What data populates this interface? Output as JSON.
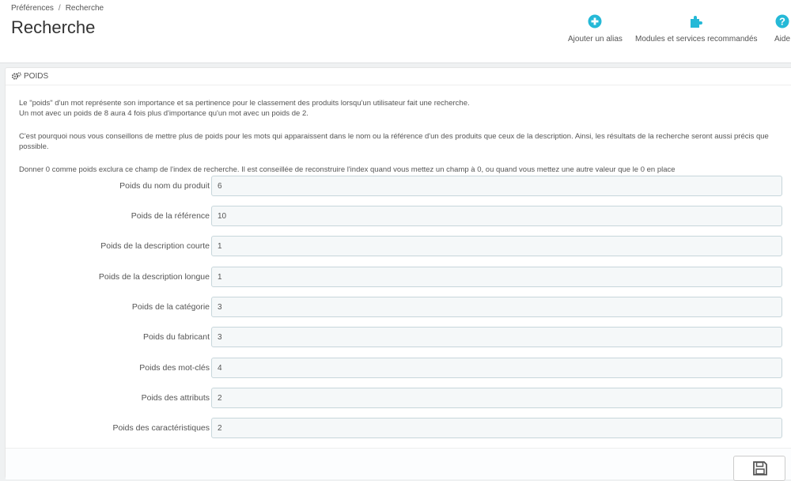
{
  "breadcrumb": {
    "parent": "Préférences",
    "separator": "/",
    "current": "Recherche"
  },
  "page_title": "Recherche",
  "toolbar": {
    "add_alias": {
      "label": "Ajouter un alias",
      "icon": "plus-circle-icon"
    },
    "modules": {
      "label": "Modules et services recommandés",
      "icon": "puzzle-icon"
    },
    "help": {
      "label": "Aide",
      "icon": "question-circle-icon"
    }
  },
  "colors": {
    "accent": "#25b9d7",
    "input_bg": "#f5f8f9",
    "input_border": "#c7d6db"
  },
  "panel": {
    "title": "POIDS",
    "info": [
      "Le \"poids\" d'un mot représente son importance et sa pertinence pour le classement des produits lorsqu'un utilisateur fait une recherche.",
      "Un mot avec un poids de 8 aura 4 fois plus d'importance qu'un mot avec un poids de 2.",
      "C'est pourquoi nous vous conseillons de mettre plus de poids pour les mots qui apparaissent dans le nom ou la référence d'un des produits que ceux de la description. Ainsi, les résultats de la recherche seront aussi précis que possible.",
      "Donner 0 comme poids exclura ce champ de l'index de recherche. Il est conseillée de reconstruire l'index quand vous mettez un champ à 0, ou quand vous mettez une autre valeur que le 0 en place"
    ],
    "fields": [
      {
        "label": "Poids du nom du produit",
        "value": "6"
      },
      {
        "label": "Poids de la référence",
        "value": "10"
      },
      {
        "label": "Poids de la description courte",
        "value": "1"
      },
      {
        "label": "Poids de la description longue",
        "value": "1"
      },
      {
        "label": "Poids de la catégorie",
        "value": "3"
      },
      {
        "label": "Poids du fabricant",
        "value": "3"
      },
      {
        "label": "Poids des mot-clés",
        "value": "4"
      },
      {
        "label": "Poids des attributs",
        "value": "2"
      },
      {
        "label": "Poids des caractéristiques",
        "value": "2"
      }
    ],
    "save_icon": "floppy-disk-icon"
  }
}
